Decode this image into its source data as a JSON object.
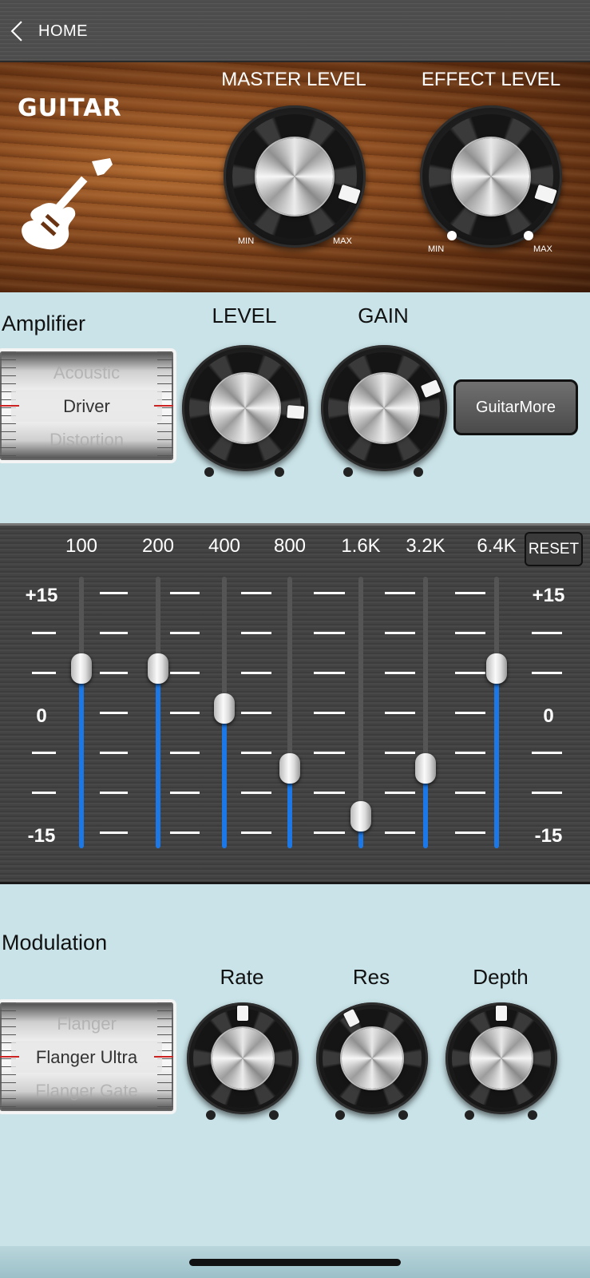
{
  "nav": {
    "back_label": "HOME"
  },
  "banner": {
    "title": "GUITAR",
    "master_label": "MASTER LEVEL",
    "effect_label": "EFFECT LEVEL",
    "min_label": "MIN",
    "max_label": "MAX",
    "master_level": 0.9,
    "effect_level": 0.9
  },
  "amplifier": {
    "title": "Amplifier",
    "options": [
      "Acoustic",
      "Driver",
      "Distortion"
    ],
    "selected": "Driver",
    "level_label": "LEVEL",
    "gain_label": "GAIN",
    "level_value": 0.85,
    "gain_value": 0.75,
    "more_button": "GuitarMore"
  },
  "equalizer": {
    "reset_label": "RESET",
    "scale_top": "+15",
    "scale_mid": "0",
    "scale_bottom": "-15",
    "bands": [
      {
        "label": "100",
        "value": 5.5
      },
      {
        "label": "200",
        "value": 5.5
      },
      {
        "label": "400",
        "value": 0.5
      },
      {
        "label": "800",
        "value": -7
      },
      {
        "label": "1.6K",
        "value": -13
      },
      {
        "label": "3.2K",
        "value": -7
      },
      {
        "label": "6.4K",
        "value": 5.5
      }
    ]
  },
  "modulation": {
    "title": "Modulation",
    "options": [
      "Flanger",
      "Flanger Ultra",
      "Flanger Gate"
    ],
    "selected": "Flanger Ultra",
    "rate_label": "Rate",
    "res_label": "Res",
    "depth_label": "Depth",
    "rate_value": 0.5,
    "res_value": 0.4,
    "depth_value": 0.5
  },
  "colors": {
    "accent": "#1b78e6",
    "background": "#c9e3e8",
    "indicator_red": "#cc2222"
  }
}
